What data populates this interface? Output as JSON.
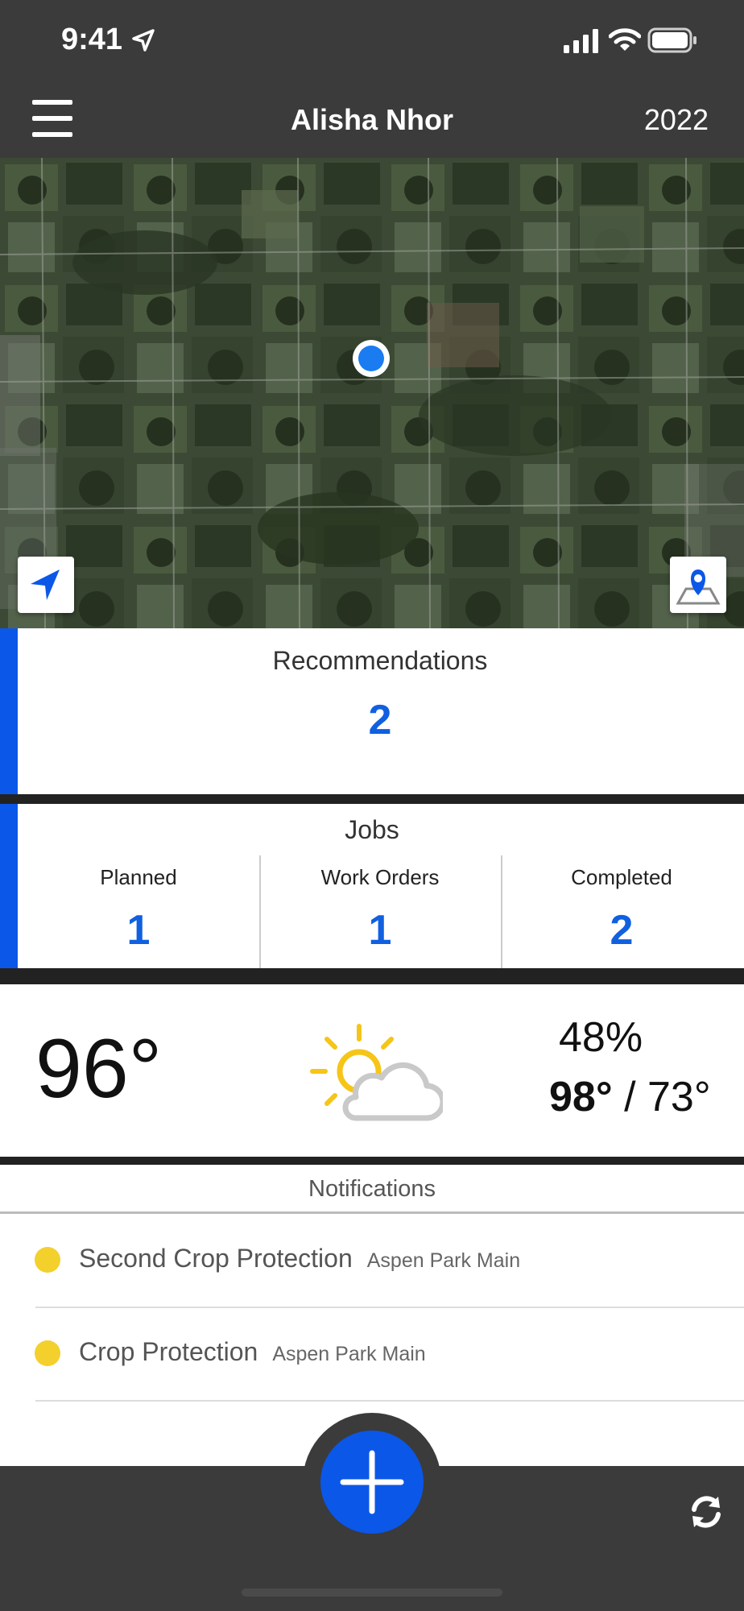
{
  "status_bar": {
    "time": "9:41"
  },
  "header": {
    "title": "Alisha Nhor",
    "year": "2022"
  },
  "recommendations": {
    "label": "Recommendations",
    "count": "2"
  },
  "jobs": {
    "label": "Jobs",
    "columns": [
      {
        "label": "Planned",
        "count": "1"
      },
      {
        "label": "Work Orders",
        "count": "1"
      },
      {
        "label": "Completed",
        "count": "2"
      }
    ]
  },
  "weather": {
    "temperature": "96°",
    "humidity": "48%",
    "high": "98°",
    "separator": " / ",
    "low": "73°",
    "condition_icon": "partly-cloudy-icon"
  },
  "notifications": {
    "title": "Notifications",
    "items": [
      {
        "title": "Second Crop Protection",
        "location": "Aspen Park Main",
        "status_color": "#f3d02c"
      },
      {
        "title": "Crop Protection",
        "location": "Aspen Park Main",
        "status_color": "#f3d02c"
      }
    ]
  },
  "colors": {
    "accent": "#0b57e8",
    "count_blue": "#1060e0",
    "bar_bg": "#3b3b3b"
  }
}
